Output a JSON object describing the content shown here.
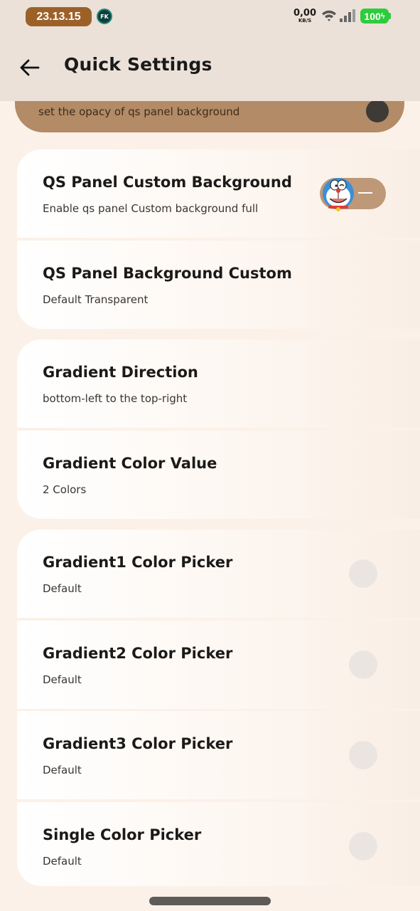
{
  "status_bar": {
    "time": "23.13.15",
    "app_icon": "FK",
    "net_speed_value": "0,00",
    "net_speed_unit": "KB/S",
    "battery": "100",
    "battery_color": "#2ecc3c"
  },
  "toolbar": {
    "title": "Quick Settings",
    "back_icon": "arrow-back-icon"
  },
  "opacity_card": {
    "description": "set the opacy of qs panel background"
  },
  "settings": {
    "items": [
      {
        "title": "QS Panel Custom Background",
        "summary": "Enable qs panel Custom background full",
        "toggle_on": true
      },
      {
        "title": "QS Panel Background Custom",
        "summary": "Default Transparent"
      },
      {
        "title": "Gradient Direction",
        "summary": "bottom-left to the top-right"
      },
      {
        "title": "Gradient Color Value",
        "summary": "2 Colors"
      },
      {
        "title": "Gradient1 Color Picker",
        "summary": "Default"
      },
      {
        "title": "Gradient2 Color Picker",
        "summary": "Default"
      },
      {
        "title": "Gradient3 Color Picker",
        "summary": "Default"
      },
      {
        "title": "Single Color Picker",
        "summary": "Default"
      }
    ]
  },
  "colors": {
    "accent": "#bf9877",
    "header_bg": "#ebe1d9",
    "page_bg": "#fbf1e8",
    "time_pill": "#9c6128"
  }
}
